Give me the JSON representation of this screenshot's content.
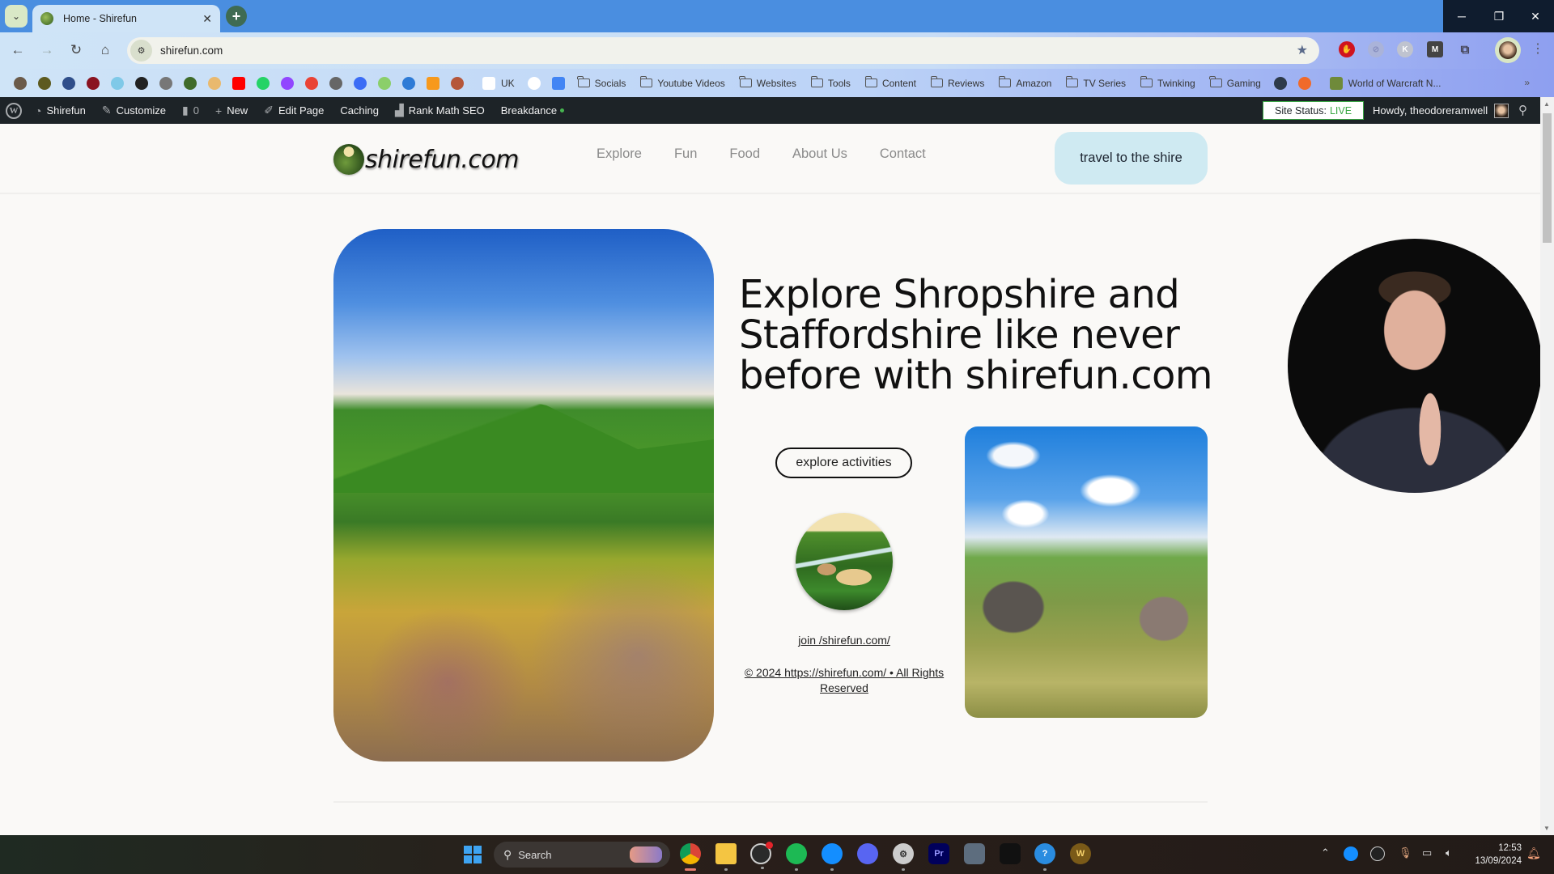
{
  "browser": {
    "tab": {
      "title": "Home - Shirefun",
      "close_glyph": "✕"
    },
    "new_tab_glyph": "+",
    "tab_search_glyph": "⌄",
    "window_controls": {
      "minimize": "─",
      "maximize": "❐",
      "close": "✕"
    },
    "nav": {
      "back": "←",
      "forward": "→",
      "reload": "↻",
      "home": "⌂"
    },
    "url": "shirefun.com",
    "site_info_glyph": "⚙",
    "bookmark_star": "★",
    "extensions": [
      {
        "name": "adblock",
        "glyph": "✋"
      },
      {
        "name": "disabled-extension",
        "glyph": "⊘"
      },
      {
        "name": "k-extension",
        "glyph": "K"
      },
      {
        "name": "m-extension",
        "glyph": "M"
      },
      {
        "name": "extensions-puzzle",
        "glyph": "⧉"
      }
    ],
    "menu_glyph": "⋮",
    "bookmarks": {
      "icons": [
        {
          "name": "bm-1",
          "color": "#6b5b4a"
        },
        {
          "name": "bm-2",
          "color": "#5d5a1f"
        },
        {
          "name": "bm-3",
          "color": "#2f4e8a"
        },
        {
          "name": "bm-4",
          "color": "#8a1320"
        },
        {
          "name": "bm-5",
          "color": "#7fc9e8"
        },
        {
          "name": "bm-pen",
          "color": "#222222"
        },
        {
          "name": "bm-7",
          "color": "#777777"
        },
        {
          "name": "bm-shirefun",
          "color": "#3f6b2a"
        },
        {
          "name": "bm-9",
          "color": "#e9b96e"
        },
        {
          "name": "bm-youtube",
          "color": "#ff0000"
        },
        {
          "name": "bm-whatsapp",
          "color": "#25d366"
        },
        {
          "name": "bm-twitch",
          "color": "#9146ff"
        },
        {
          "name": "bm-gmail",
          "color": "#ea4335"
        },
        {
          "name": "bm-ox",
          "color": "#666666"
        },
        {
          "name": "bm-canva",
          "color": "#3b6cf5"
        },
        {
          "name": "bm-16",
          "color": "#8bcf6a"
        },
        {
          "name": "bm-17",
          "color": "#2e7bd6"
        },
        {
          "name": "bm-audible",
          "color": "#f7991c"
        },
        {
          "name": "bm-19",
          "color": "#b5563a"
        }
      ],
      "amazon_label": "UK",
      "after_amazon_icons": [
        {
          "name": "bm-openai",
          "color": "#ffffff"
        },
        {
          "name": "bm-docs",
          "color": "#4285f4"
        }
      ],
      "folders": [
        "Socials",
        "Youtube Videos",
        "Websites",
        "Tools",
        "Content",
        "Reviews",
        "Amazon",
        "TV Series",
        "Twinking",
        "Gaming"
      ],
      "trailing": [
        {
          "name": "bm-globe",
          "color": "#2d3a4a"
        },
        {
          "name": "bm-orange",
          "color": "#f06a2a"
        }
      ],
      "wow_label": "World of Warcraft N...",
      "more_glyph": "»"
    }
  },
  "wp_admin_bar": {
    "site_name": "Shirefun",
    "customize": "Customize",
    "comments_count": "0",
    "new": "New",
    "edit_page": "Edit Page",
    "caching": "Caching",
    "rank_math": "Rank Math SEO",
    "breakdance": "Breakdance",
    "site_status_label": "Site Status:",
    "site_status_value": "LIVE",
    "howdy": "Howdy, theodoreramwell"
  },
  "site": {
    "logo_text": "shirefun.com",
    "nav": [
      "Explore",
      "Fun",
      "Food",
      "About Us",
      "Contact"
    ],
    "cta": "travel to the shire",
    "hero_heading": "Explore Shropshire and Staffordshire like never before with shirefun.com",
    "explore_button": "explore activities",
    "join_link": "join /shirefun.com/",
    "copyright": "© 2024 https://shirefun.com/  •  All Rights Reserved",
    "colors": {
      "cta_bg": "#cfeaf2",
      "text": "#111111",
      "page_bg": "#faf9f7"
    }
  },
  "taskbar": {
    "search_label": "Search",
    "apps": [
      "Chrome",
      "File Explorer",
      "OBS",
      "Spotify",
      "Battle.net",
      "Discord",
      "Settings",
      "Premiere Pro",
      "Calculator",
      "Anvil",
      "Get Help",
      "World of Warcraft"
    ],
    "premiere_label": "Pr",
    "wow_label": "W",
    "time": "12:53",
    "date": "13/09/2024"
  }
}
